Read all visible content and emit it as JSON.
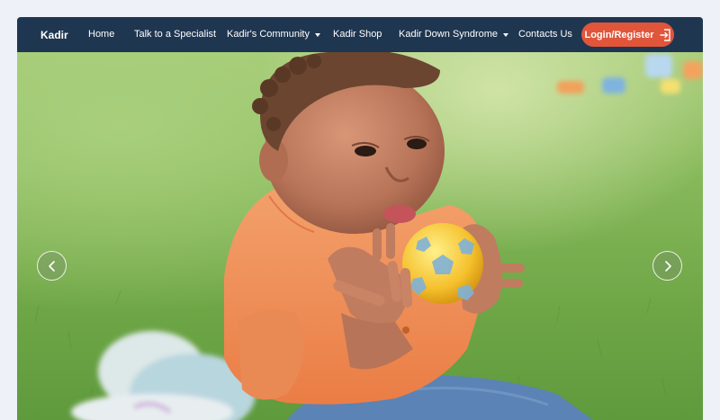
{
  "nav": {
    "brand": "Kadir",
    "items": [
      {
        "label": "Home",
        "dropdown": false
      },
      {
        "label": "Talk to a Specialist",
        "dropdown": false
      },
      {
        "label": "Kadir's Community",
        "dropdown": true
      },
      {
        "label": "Kadir Shop",
        "dropdown": false
      },
      {
        "label": "Kadir Down Syndrome",
        "dropdown": true
      },
      {
        "label": "Contacts Us",
        "dropdown": false
      }
    ],
    "login_label": "Login/Register"
  },
  "colors": {
    "navbar": "#1f3650",
    "login_button": "#e1553a",
    "background": "#eef1f8"
  },
  "carousel": {
    "prev_icon": "chevron-left-icon",
    "next_icon": "chevron-right-icon"
  }
}
